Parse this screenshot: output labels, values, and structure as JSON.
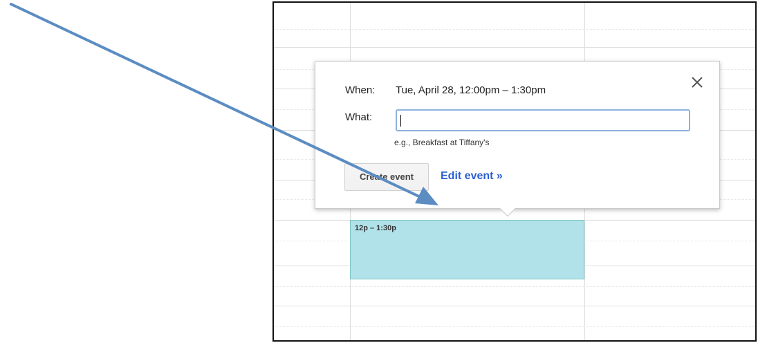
{
  "event": {
    "time_label": "12p – 1:30p"
  },
  "popup": {
    "when_label": "When:",
    "when_value": "Tue, April 28, 12:00pm – 1:30pm",
    "what_label": "What:",
    "what_value": "",
    "what_placeholder": "",
    "hint_text": "e.g., Breakfast at Tiffany's",
    "close_icon": "close-icon",
    "create_button_label": "Create event",
    "edit_link_label": "Edit event »"
  },
  "colors": {
    "event_fill": "#b1e2ea",
    "event_border": "#7bc7c4",
    "link": "#2a5fd0",
    "input_focus_border": "#8fb0dd",
    "annotation_arrow": "#5b8cc2"
  },
  "annotation": {
    "icon": "arrow-icon"
  }
}
